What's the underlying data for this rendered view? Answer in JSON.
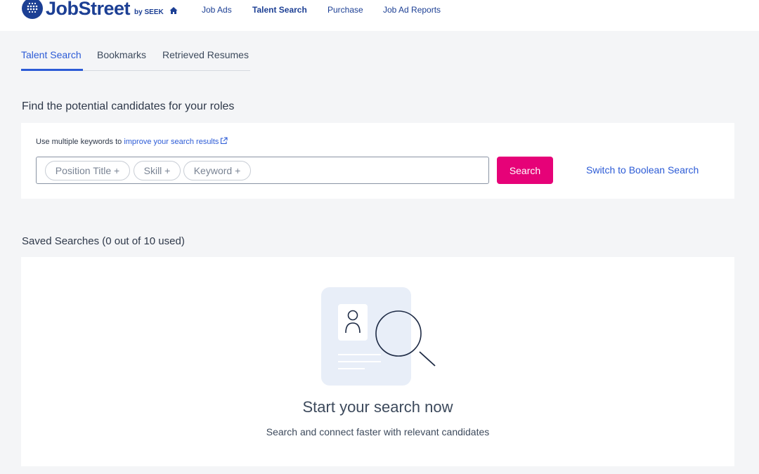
{
  "header": {
    "logo_text": "JobStreet",
    "logo_by": "by SEEK",
    "nav": [
      {
        "label": "Job Ads",
        "active": false
      },
      {
        "label": "Talent Search",
        "active": true
      },
      {
        "label": "Purchase",
        "active": false
      },
      {
        "label": "Job Ad Reports",
        "active": false
      }
    ],
    "home_icon": "home-icon"
  },
  "tabs": [
    {
      "label": "Talent Search",
      "active": true
    },
    {
      "label": "Bookmarks",
      "active": false
    },
    {
      "label": "Retrieved Resumes",
      "active": false
    }
  ],
  "search": {
    "heading": "Find the potential candidates for your roles",
    "hint_prefix": "Use multiple keywords to ",
    "hint_link": "improve your search results",
    "chips": [
      "Position Title +",
      "Skill +",
      "Keyword +"
    ],
    "button_label": "Search",
    "boolean_link": "Switch to Boolean Search"
  },
  "saved": {
    "heading": "Saved Searches (0 out of 10 used)",
    "empty_title": "Start your search now",
    "empty_subtitle": "Search and connect faster with relevant candidates"
  },
  "colors": {
    "brand": "#1c3f94",
    "accent": "#e60278",
    "link": "#2c5bd6"
  }
}
